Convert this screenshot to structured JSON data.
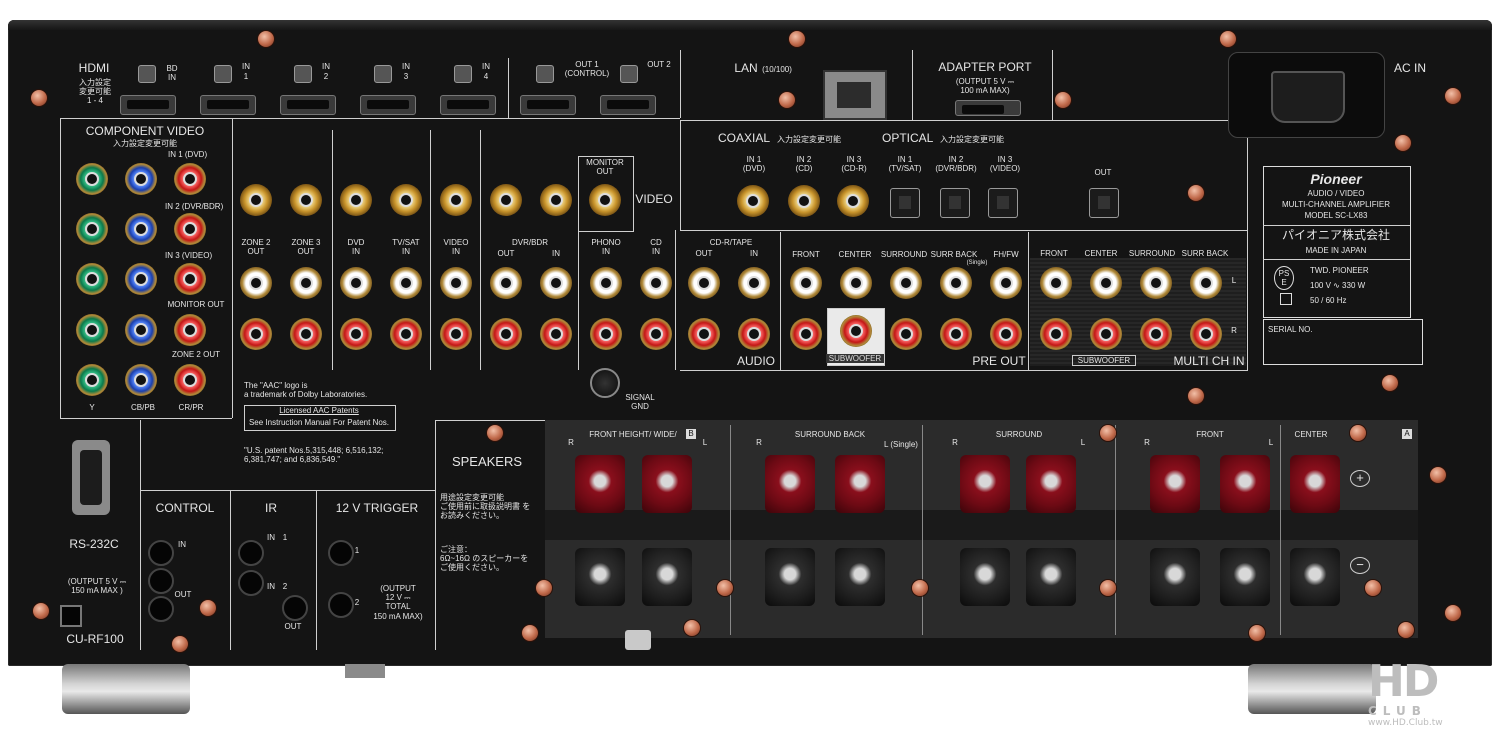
{
  "hdmi": {
    "title": "HDMI",
    "jp_note": "入力設定\n変更可能\n1 - 4",
    "bd_in": "BD\nIN",
    "in1": "IN",
    "in1_n": "1",
    "in2": "IN",
    "in2_n": "2",
    "in3": "IN",
    "in3_n": "3",
    "in4": "IN",
    "in4_n": "4",
    "out1": "OUT 1\n(CONTROL)",
    "out2": "OUT 2"
  },
  "lan": {
    "label": "LAN",
    "sub": "(10/100)"
  },
  "adapter_port": {
    "title": "ADAPTER PORT",
    "sub": "(OUTPUT 5 V ⎓\n100 mA MAX)"
  },
  "ac_in": "AC IN",
  "component_video": {
    "title": "COMPONENT VIDEO",
    "jp": "入力設定変更可能",
    "in1": "IN 1   (DVD)",
    "in2": "IN 2  (DVR/BDR)",
    "in3": "IN 3   (VIDEO)",
    "monitor_out": "MONITOR OUT",
    "zone2_out": "ZONE 2 OUT",
    "y": "Y",
    "pb": "CB/PB",
    "pr": "CR/PR"
  },
  "video": {
    "label": "VIDEO",
    "monitor_out": "MONITOR\nOUT",
    "zone2_out": "ZONE 2\nOUT",
    "zone3_out": "ZONE 3\nOUT",
    "dvd_in": "DVD\nIN",
    "tvsat_in": "TV/SAT\nIN",
    "video_in": "VIDEO\nIN",
    "dvrbdr": "DVR/BDR",
    "out": "OUT",
    "in": "IN",
    "phono_in": "PHONO\nIN",
    "cd_in": "CD\nIN",
    "cdr_tape": "CD-R/TAPE",
    "audio": "AUDIO"
  },
  "digital": {
    "coaxial": "COAXIAL",
    "coax_jp": "入力設定変更可能",
    "coax_in1": "IN 1\n(DVD)",
    "coax_in2": "IN 2\n(CD)",
    "coax_in3": "IN 3\n(CD-R)",
    "optical": "OPTICAL",
    "opt_jp": "入力設定変更可能",
    "opt_in1": "IN 1\n(TV/SAT)",
    "opt_in2": "IN 2\n(DVR/BDR)",
    "opt_in3": "IN 3\n(VIDEO)",
    "opt_out": "OUT"
  },
  "pre_out": {
    "front": "FRONT",
    "center": "CENTER",
    "surround": "SURROUND",
    "surr_back": "SURR BACK",
    "single": "(Single)",
    "fhfw": "FH/FW",
    "subwoofer": "SUBWOOFER",
    "label": "PRE OUT"
  },
  "multi_ch": {
    "front": "FRONT",
    "center": "CENTER",
    "surround": "SURROUND",
    "surr_back": "SURR BACK",
    "l": "L",
    "r": "R",
    "subwoofer": "SUBWOOFER",
    "label": "MULTI CH IN"
  },
  "rating": {
    "brand": "Pioneer",
    "line1": "AUDIO / VIDEO",
    "line2": "MULTI-CHANNEL AMPLIFIER",
    "model": "MODEL  SC-LX83",
    "jp_company": "パイオニア株式会社",
    "made_in": "MADE IN JAPAN",
    "twd": "TWD. PIONEER",
    "power": "100 V ∿ 330 W",
    "freq": "50 / 60 Hz",
    "pse": "PS\nE",
    "serial": "SERIAL NO."
  },
  "aac": {
    "logo_note": "The \"AAC\" logo is\na trademark of Dolby Laboratories.",
    "licensed": "Licensed AAC Patents",
    "see_manual": "See Instruction Manual For Patent Nos.",
    "patents": "\"U.S. patent Nos.5,315,448; 6,516,132;\n6,381,747; and 6,836,549.\""
  },
  "signal_gnd": "SIGNAL\nGND",
  "rs232c": "RS-232C",
  "cu_rf": {
    "output": "(OUTPUT 5 V ⎓\n150 mA MAX )",
    "label": "CU-RF100"
  },
  "control": {
    "label": "CONTROL",
    "in": "IN",
    "out": "OUT"
  },
  "ir": {
    "label": "IR",
    "in": "IN",
    "n1": "1",
    "n2": "2",
    "out": "OUT"
  },
  "trigger": {
    "label": "12 V TRIGGER",
    "n1": "1",
    "n2": "2",
    "output": "(OUTPUT\n12 V ⎓\nTOTAL\n150 mA MAX)"
  },
  "speakers": {
    "label": "SPEAKERS",
    "jp_note": "用途設定変更可能\nご使用前に取扱説明書 を\nお読みください。",
    "jp_caution": "ご注意：\n6Ω~16Ω のスピーカーを\nご使用ください。",
    "front_height_wide": "FRONT HEIGHT/ WIDE/",
    "b": "B",
    "surround_back": "SURROUND BACK",
    "l_single": "L (Single)",
    "surround": "SURROUND",
    "front": "FRONT",
    "center": "CENTER",
    "a": "A",
    "r": "R",
    "l": "L",
    "plus": "+",
    "minus": "−"
  },
  "watermark": {
    "logo": "HD",
    "club": "CLUB",
    "url": "www.HD.Club.tw"
  }
}
